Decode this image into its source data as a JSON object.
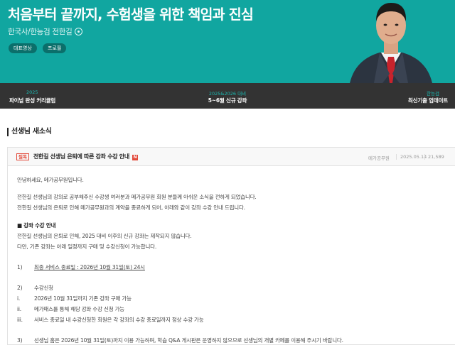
{
  "hero": {
    "title": "처음부터 끝까지, 수험생을 위한 책임과 진심",
    "subtitle": "한국사/한능검 전한길",
    "buttons": [
      "대표영상",
      "프로필"
    ],
    "bg_color": "#11a6a0"
  },
  "menu": {
    "items": [
      {
        "top": "2025",
        "bottom": "파이널 완성 커리큘럼"
      },
      {
        "top": "2025&2026 대비",
        "bottom": "5~6월 신규 강좌"
      },
      {
        "top": "한능검",
        "bottom": "최신기출 업데이트"
      }
    ]
  },
  "section": {
    "title": "선생님 새소식"
  },
  "post": {
    "badge": "필독",
    "title": "전한길 선생님 은퇴에 따른 강좌 수강 안내",
    "new_icon": "N",
    "author": "메가공무원",
    "date": "2025.05.14",
    "views": "21,589",
    "lines": {
      "greeting": "안녕하세요, 메가공무원입니다.",
      "p1": "전한길 선생님의 강의로 공부해주신 수강생 여러분과 메가공무원 회원 분들께 아쉬운 소식을 전하게 되었습니다.",
      "p2": "전한길 선생님의 은퇴로 인해 메가공무원과의 계약을 종료하게 되어, 아래와 같이 강좌 수강 안내 드립니다.",
      "heading": "■ 강좌 수강 안내",
      "p3": "전한길 선생님의 은퇴로 인해, 2025 대비 이후의 신규 강좌는 제작되지 않습니다.",
      "p4": "다만, 기존 강좌는 아래 일정까지 구매 및 수강신청이 가능합니다.",
      "n1": "1)",
      "item1": "최종 서비스 종료일 : 2026년 10월 31일(토) 24시",
      "n2": "2)",
      "item2": "수강신청",
      "r1": "i.",
      "sub1": "2026년 10월 31일까지 기존 강좌 구매 가능",
      "r2": "ii.",
      "sub2": "메가패스를 통해 해당 강좌 수강 신청 가능",
      "r3": "iii.",
      "sub3": "서비스 종료일 내 수강신청한 회원은 각 강좌의 수강 종료일까지 정상 수강 가능",
      "n3": "3)",
      "item3": "선생님 홈은 2026년 10월 31일(토)까지 이용 가능하며, 학습 Q&A 게시판은 운영하지 않으므로 선생님의 개별 카페를 이용해 주시기 바랍니다."
    }
  },
  "colors": {
    "teal": "#11a6a0",
    "dark_strip": "#333333",
    "menu_accent": "#1bb8b0",
    "badge_red": "#e24a3b"
  },
  "icons": [
    "play-circle-icon",
    "new-icon",
    "instructor-photo"
  ]
}
